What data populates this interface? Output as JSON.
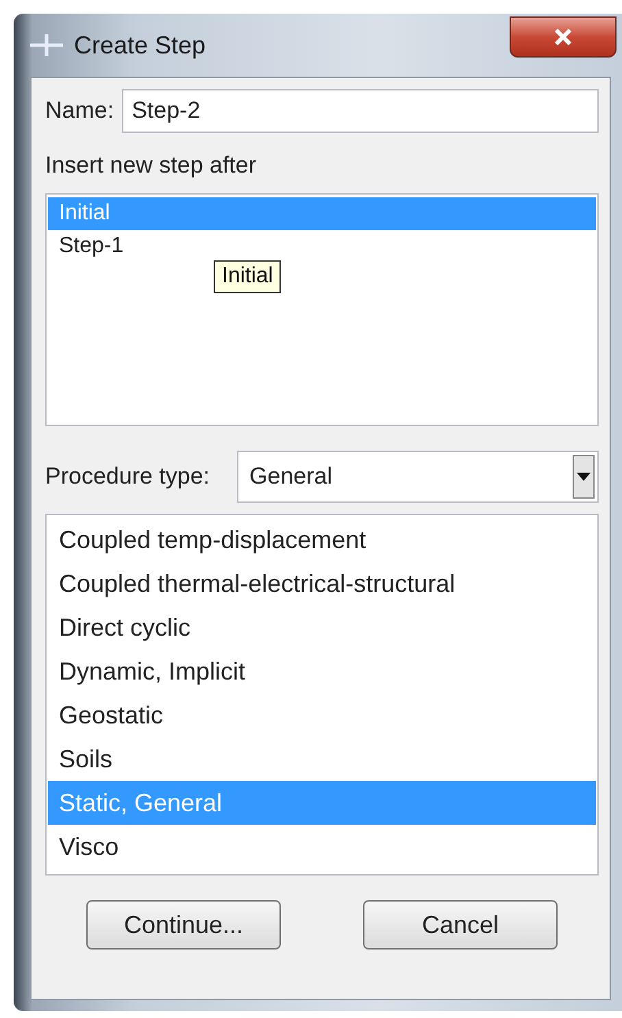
{
  "window": {
    "title": "Create Step"
  },
  "name_field": {
    "label": "Name:",
    "value": "Step-2"
  },
  "insert_after": {
    "label": "Insert new step after",
    "items": [
      {
        "label": "Initial",
        "selected": true
      },
      {
        "label": "Step-1",
        "selected": false
      }
    ],
    "tooltip": "Initial"
  },
  "procedure_type": {
    "label": "Procedure type:",
    "value": "General"
  },
  "procedures": [
    {
      "label": "Coupled temp-displacement",
      "selected": false
    },
    {
      "label": "Coupled thermal-electrical-structural",
      "selected": false
    },
    {
      "label": "Direct cyclic",
      "selected": false
    },
    {
      "label": "Dynamic, Implicit",
      "selected": false
    },
    {
      "label": "Geostatic",
      "selected": false
    },
    {
      "label": "Soils",
      "selected": false
    },
    {
      "label": "Static, General",
      "selected": true
    },
    {
      "label": "Visco",
      "selected": false
    }
  ],
  "buttons": [
    {
      "label": "Continue..."
    },
    {
      "label": "Cancel"
    }
  ]
}
